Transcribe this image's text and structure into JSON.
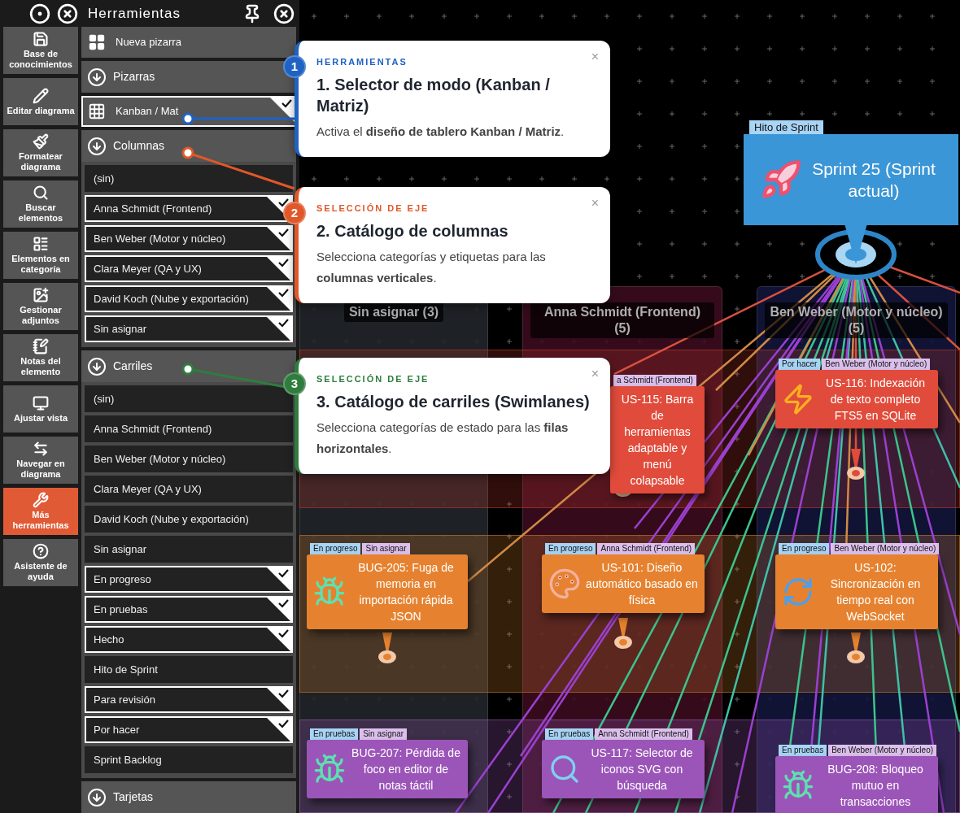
{
  "panel": {
    "title": "Herramientas"
  },
  "tools": [
    {
      "label": "Base de conocimientos",
      "selected": false
    },
    {
      "label": "Editar diagrama",
      "selected": false
    },
    {
      "label": "Formatear diagrama",
      "selected": false
    },
    {
      "label": "Buscar elementos",
      "selected": false
    },
    {
      "label": "Elementos en categoría",
      "selected": false
    },
    {
      "label": "Gestionar adjuntos",
      "selected": false
    },
    {
      "label": "Notas del elemento",
      "selected": false
    },
    {
      "label": "Ajustar vista",
      "selected": false
    },
    {
      "label": "Navegar en diagrama",
      "selected": false
    },
    {
      "label": "Más herramientas",
      "selected": true
    },
    {
      "label": "Asistente de ayuda",
      "selected": false
    }
  ],
  "menu": [
    {
      "kind": "button",
      "label": "Nueva pizarra"
    },
    {
      "kind": "section",
      "label": "Pizarras"
    },
    {
      "kind": "option",
      "label": "Kanban / Mat",
      "checked": true
    },
    {
      "kind": "section",
      "label": "Columnas",
      "items": [
        {
          "label": "(sin)",
          "checked": false
        },
        {
          "label": "Anna Schmidt (Frontend)",
          "checked": true
        },
        {
          "label": "Ben Weber (Motor y núcleo)",
          "checked": true
        },
        {
          "label": "Clara Meyer (QA y UX)",
          "checked": true
        },
        {
          "label": "David Koch (Nube y exportación)",
          "checked": true
        },
        {
          "label": "Sin asignar",
          "checked": true
        }
      ]
    },
    {
      "kind": "section",
      "label": "Carriles",
      "items": [
        {
          "label": "(sin)",
          "checked": false
        },
        {
          "label": "Anna Schmidt (Frontend)",
          "checked": false
        },
        {
          "label": "Ben Weber (Motor y núcleo)",
          "checked": false
        },
        {
          "label": "Clara Meyer (QA y UX)",
          "checked": false
        },
        {
          "label": "David Koch (Nube y exportación)",
          "checked": false
        },
        {
          "label": "Sin asignar",
          "checked": false
        },
        {
          "label": "En progreso",
          "checked": true
        },
        {
          "label": "En pruebas",
          "checked": true
        },
        {
          "label": "Hecho",
          "checked": true
        },
        {
          "label": "Hito de Sprint",
          "checked": false
        },
        {
          "label": "Para revisión",
          "checked": true
        },
        {
          "label": "Por hacer",
          "checked": true
        },
        {
          "label": "Sprint Backlog",
          "checked": false
        }
      ]
    },
    {
      "kind": "section",
      "label": "Tarjetas"
    }
  ],
  "callouts": [
    {
      "number": "1",
      "category": "HERRAMIENTAS",
      "title": "1. Selector de modo (Kanban / Matriz)",
      "body": "Activa el **diseño de tablero Kanban / Matriz**.",
      "color": "#1f62c4",
      "close": "×"
    },
    {
      "number": "2",
      "category": "SELECCIÓN DE EJE",
      "title": "2. Catálogo de columnas",
      "body": "Selecciona categorías y etiquetas para las **columnas verticales**.",
      "color": "#e0582a",
      "close": "×"
    },
    {
      "number": "3",
      "category": "SELECCIÓN DE EJE",
      "title": "3. Catálogo de carriles (Swimlanes)",
      "body": "Selecciona categorías de estado para las **filas horizontales**.",
      "color": "#2e7d3e",
      "close": "×"
    }
  ],
  "board": {
    "columns": [
      {
        "title": "Sin asignar (3)",
        "color": "#22252a"
      },
      {
        "title": "Anna Schmidt (Frontend) (5)",
        "color": "#3b0d1e"
      },
      {
        "title": "Ben Weber (Motor y núcleo) (5)",
        "color": "#12163a"
      }
    ],
    "lanes": [
      {
        "color": "#c0392b"
      },
      {
        "color": "#d07a2a"
      },
      {
        "color": "#9b59b6"
      }
    ],
    "milestone": {
      "tag": "Hito de Sprint",
      "title": "Sprint 25 (Sprint actual)"
    },
    "cards": [
      {
        "owner": "a Schmidt (Frontend)",
        "title": "US-115: Barra de herramientas adaptable y menú colapsable",
        "color": "#e04b3b"
      },
      {
        "status": "Por hacer",
        "owner": "Ben Weber (Motor y núcleo)",
        "title": "US-116: Indexación de texto completo FTS5 en SQLite",
        "color": "#e04b3b"
      },
      {
        "status": "En progreso",
        "owner": "Sin asignar",
        "title": "BUG-205: Fuga de memoria en importación rápida JSON",
        "color": "#e6822f"
      },
      {
        "status": "En progreso",
        "owner": "Anna Schmidt (Frontend)",
        "title": "US-101: Diseño automático basado en física",
        "color": "#e6822f"
      },
      {
        "status": "En progreso",
        "owner": "Ben Weber (Motor y núcleo)",
        "title": "US-102: Sincronización en tiempo real con WebSocket",
        "color": "#e6822f"
      },
      {
        "status": "En pruebas",
        "owner": "Sin asignar",
        "title": "BUG-207: Pérdida de foco en editor de notas táctil",
        "color": "#9b55b8"
      },
      {
        "status": "En pruebas",
        "owner": "Anna Schmidt (Frontend)",
        "title": "US-117: Selector de iconos SVG con búsqueda",
        "color": "#9b55b8"
      },
      {
        "status": "En pruebas",
        "owner": "Ben Weber (Motor y núcleo)",
        "title": "BUG-208: Bloqueo mutuo en transacciones",
        "color": "#9b55b8"
      }
    ]
  }
}
